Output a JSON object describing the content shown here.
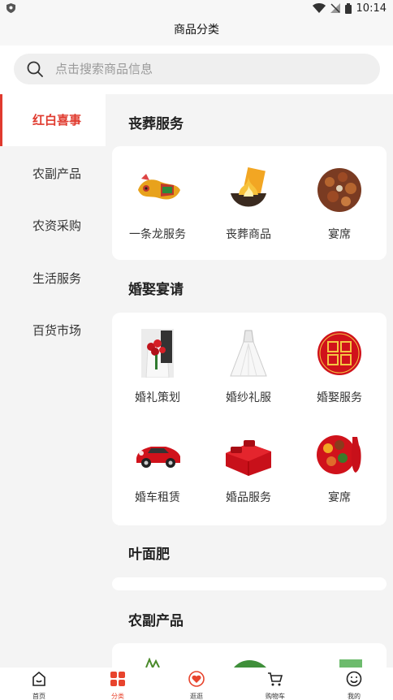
{
  "status": {
    "time": "10:14"
  },
  "header": {
    "title": "商品分类"
  },
  "search": {
    "placeholder": "点击搜索商品信息"
  },
  "sidebar": {
    "items": [
      {
        "label": "红白喜事",
        "active": true
      },
      {
        "label": "农副产品",
        "active": false
      },
      {
        "label": "农资采购",
        "active": false
      },
      {
        "label": "生活服务",
        "active": false
      },
      {
        "label": "百货市场",
        "active": false
      }
    ]
  },
  "sections": [
    {
      "title": "丧葬服务",
      "items": [
        {
          "label": "一条龙服务",
          "icon": "dragon-icon"
        },
        {
          "label": "丧葬商品",
          "icon": "paper-offering-icon"
        },
        {
          "label": "宴席",
          "icon": "feast-icon"
        }
      ]
    },
    {
      "title": "婚娶宴请",
      "items": [
        {
          "label": "婚礼策划",
          "icon": "bouquet-icon"
        },
        {
          "label": "婚纱礼服",
          "icon": "wedding-dress-icon"
        },
        {
          "label": "婚娶服务",
          "icon": "double-happiness-icon"
        },
        {
          "label": "婚车租赁",
          "icon": "wedding-car-icon"
        },
        {
          "label": "婚品服务",
          "icon": "red-bedding-icon"
        },
        {
          "label": "宴席",
          "icon": "banquet-icon"
        }
      ]
    },
    {
      "title": "叶面肥",
      "items": []
    },
    {
      "title": "农副产品",
      "items": []
    }
  ],
  "tabs": [
    {
      "label": "首页",
      "icon": "home-icon"
    },
    {
      "label": "分类",
      "icon": "category-icon",
      "active": true
    },
    {
      "label": "逛逛",
      "icon": "heart-icon"
    },
    {
      "label": "购物车",
      "icon": "cart-icon"
    },
    {
      "label": "我的",
      "icon": "profile-icon"
    }
  ],
  "colors": {
    "accent": "#e03a2e",
    "background": "#f4f4f4",
    "card": "#ffffff"
  }
}
